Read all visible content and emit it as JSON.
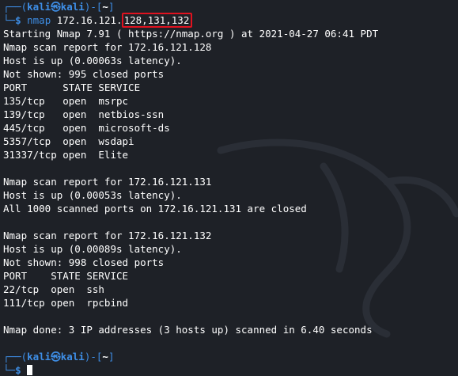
{
  "prompt": {
    "top_prefix": "┌──(",
    "user": "kali",
    "at_symbol": "㉿",
    "host": "kali",
    "mid": ")-[",
    "cwd": "~",
    "end": "]",
    "bottom_prefix": "└─",
    "dollar": "$"
  },
  "command": {
    "name": "nmap",
    "target_prefix": "172.16.121.",
    "target_hosts": "128,131,132"
  },
  "output": {
    "start_line": "Starting Nmap 7.91 ( https://nmap.org ) at 2021-04-27 06:41 PDT",
    "hosts": [
      {
        "report": "Nmap scan report for 172.16.121.128",
        "status": "Host is up (0.00063s latency).",
        "note": "Not shown: 995 closed ports",
        "header": "PORT      STATE SERVICE",
        "ports": [
          "135/tcp   open  msrpc",
          "139/tcp   open  netbios-ssn",
          "445/tcp   open  microsoft-ds",
          "5357/tcp  open  wsdapi",
          "31337/tcp open  Elite"
        ]
      },
      {
        "report": "Nmap scan report for 172.16.121.131",
        "status": "Host is up (0.00053s latency).",
        "note": "All 1000 scanned ports on 172.16.121.131 are closed"
      },
      {
        "report": "Nmap scan report for 172.16.121.132",
        "status": "Host is up (0.00089s latency).",
        "note": "Not shown: 998 closed ports",
        "header": "PORT    STATE SERVICE",
        "ports": [
          "22/tcp  open  ssh",
          "111/tcp open  rpcbind"
        ]
      }
    ],
    "done_line": "Nmap done: 3 IP addresses (3 hosts up) scanned in 6.40 seconds"
  },
  "colors": {
    "background": "#1e2127",
    "prompt_blue": "#3e8ee6",
    "highlight_red": "#e0121f",
    "text": "#ffffff"
  }
}
